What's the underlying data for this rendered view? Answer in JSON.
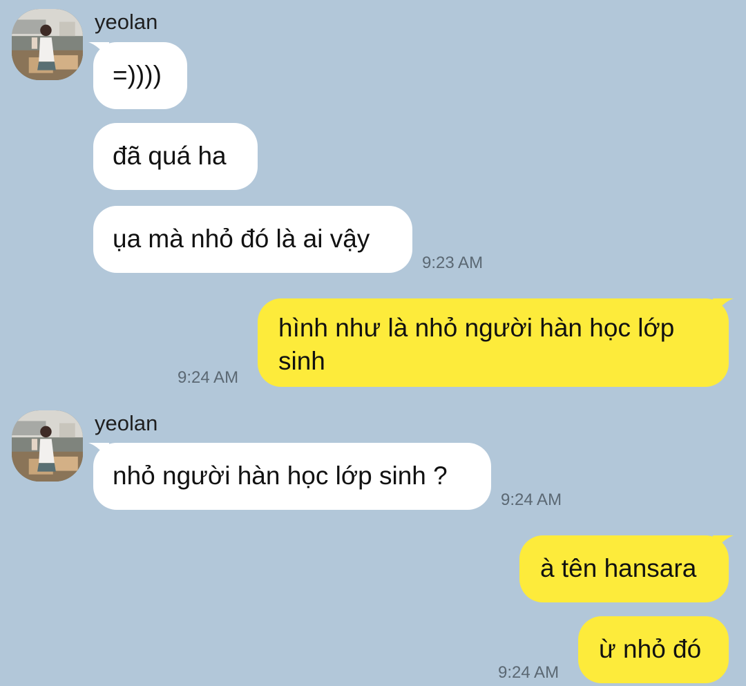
{
  "theme": {
    "background": "#b2c7d9",
    "incoming_bubble": "#ffffff",
    "outgoing_bubble": "#fdeb3b"
  },
  "messages": [
    {
      "direction": "in",
      "sender": "yeolan",
      "avatar": "profile-photo",
      "text": "=))))"
    },
    {
      "direction": "in",
      "text": "đã quá ha"
    },
    {
      "direction": "in",
      "text": "ụa mà nhỏ đó là ai vậy",
      "time": "9:23 AM"
    },
    {
      "direction": "out",
      "lines": [
        "hình như là nhỏ người hàn học lớp",
        "sinh"
      ],
      "time": "9:24 AM"
    },
    {
      "direction": "in",
      "sender": "yeolan",
      "avatar": "profile-photo",
      "text": "nhỏ người hàn học lớp sinh ?",
      "time": "9:24 AM"
    },
    {
      "direction": "out",
      "text": "à tên hansara"
    },
    {
      "direction": "out",
      "text": "ừ nhỏ đó",
      "time": "9:24 AM"
    }
  ]
}
